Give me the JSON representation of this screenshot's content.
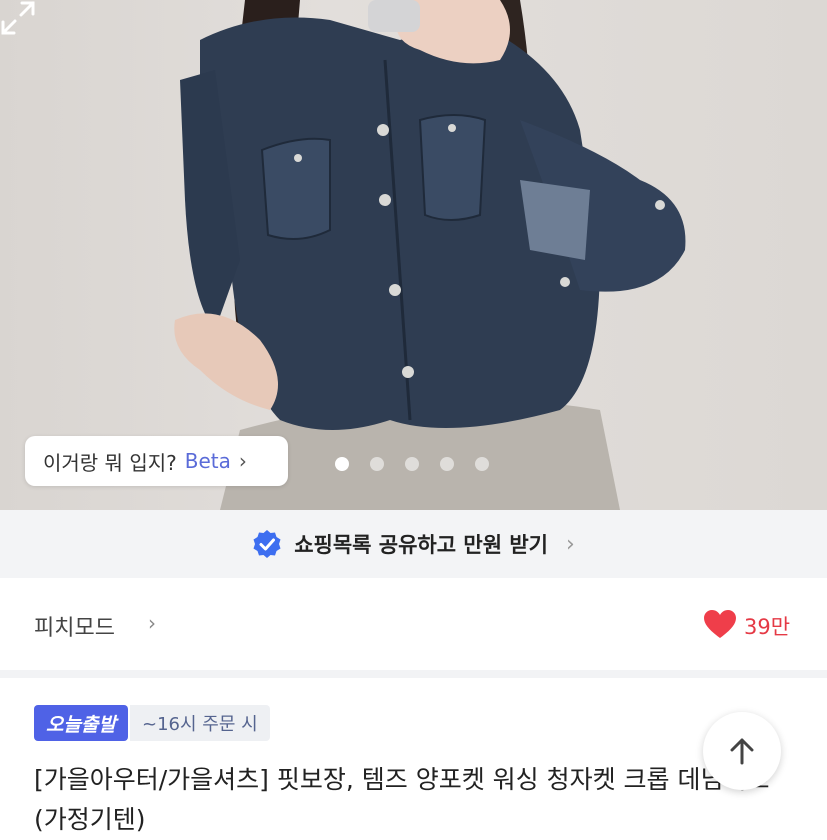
{
  "product_image": {
    "ask_chip": {
      "label": "이거랑 뭐 입지?",
      "beta": "Beta",
      "chevron": "›"
    },
    "carousel": {
      "count": 5,
      "active_index": 0
    },
    "expand_icon": "expand-icon"
  },
  "share_banner": {
    "label": "쇼핑목록 공유하고 만원 받기",
    "chevron": "›",
    "icon": "verified-check-icon"
  },
  "brand": {
    "name": "피치모드",
    "chevron": "›",
    "likes": "39만",
    "heart_color": "#ef3e4a"
  },
  "delivery": {
    "badge": "오늘출발",
    "cutoff": "~16시 주문 시"
  },
  "product": {
    "title": "[가을아우터/가을셔츠] 핏보장, 템즈 양포켓 워싱 청자켓 크롭 데님셔츠 (가정기텐)"
  },
  "scroll_top": {
    "icon": "arrow-up-icon"
  },
  "colors": {
    "accent": "#4f62e6",
    "like": "#e53945",
    "denim": "#2f3d52"
  }
}
